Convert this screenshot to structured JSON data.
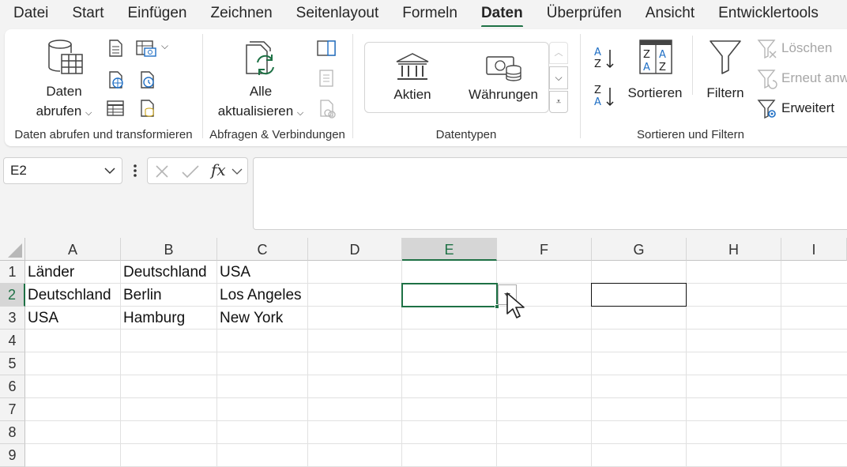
{
  "menu": {
    "tabs": [
      "Datei",
      "Start",
      "Einfügen",
      "Zeichnen",
      "Seitenlayout",
      "Formeln",
      "Daten",
      "Überprüfen",
      "Ansicht",
      "Entwicklertools"
    ],
    "active": "Daten"
  },
  "ribbon": {
    "get_transform": {
      "label": "Daten abrufen und transformieren",
      "get_data_line1": "Daten",
      "get_data_line2": "abrufen"
    },
    "queries": {
      "label": "Abfragen & Verbindungen",
      "refresh_line1": "Alle",
      "refresh_line2": "aktualisieren"
    },
    "datatypes": {
      "label": "Datentypen",
      "stocks": "Aktien",
      "currencies": "Währungen"
    },
    "sort_filter": {
      "label": "Sortieren und Filtern",
      "sort": "Sortieren",
      "filter": "Filtern",
      "clear": "Löschen",
      "reapply": "Erneut anwe",
      "advanced": "Erweitert"
    }
  },
  "formula_bar": {
    "name_box": "E2",
    "fx": "fx",
    "content": ""
  },
  "sheet": {
    "columns": [
      "A",
      "B",
      "C",
      "D",
      "E",
      "F",
      "G",
      "H",
      "I"
    ],
    "rows": [
      "1",
      "2",
      "3",
      "4",
      "5",
      "6",
      "7",
      "8",
      "9"
    ],
    "cells": {
      "A1": "Länder",
      "B1": "Deutschland",
      "C1": "USA",
      "A2": "Deutschland",
      "B2": "Berlin",
      "C2": "Los Angeles",
      "A3": "USA",
      "B3": "Hamburg",
      "C3": "New York"
    },
    "selected_cell": "E2"
  },
  "colors": {
    "accent": "#1e7145",
    "ribbon_bg": "#ffffff",
    "app_bg": "#f3f3f3"
  }
}
